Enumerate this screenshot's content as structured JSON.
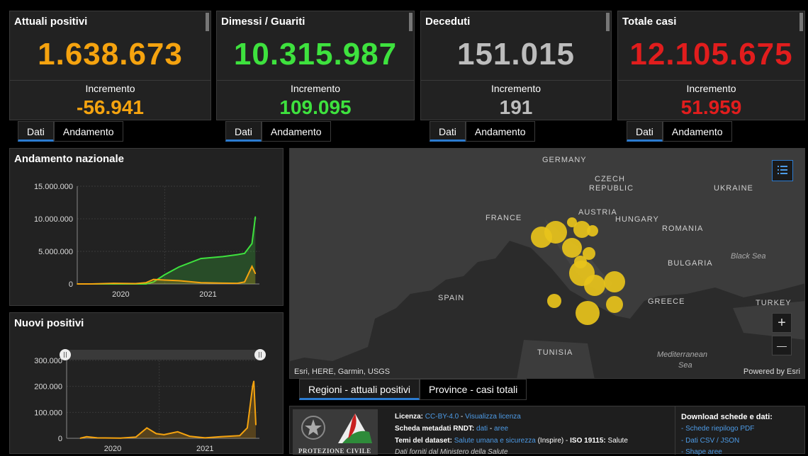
{
  "colors": {
    "orange": "#f5a30f",
    "green": "#3ee23e",
    "gray": "#bdbdbd",
    "red": "#e11d1d",
    "link": "#4d9be6"
  },
  "cards": [
    {
      "title": "Attuali positivi",
      "value": "1.638.673",
      "inc_label": "Incremento",
      "inc_value": "-56.941",
      "color": "orange",
      "tabs": [
        "Dati",
        "Andamento"
      ]
    },
    {
      "title": "Dimessi / Guariti",
      "value": "10.315.987",
      "inc_label": "Incremento",
      "inc_value": "109.095",
      "color": "green",
      "tabs": [
        "Dati",
        "Andamento"
      ]
    },
    {
      "title": "Deceduti",
      "value": "151.015",
      "inc_label": "Incremento",
      "inc_value": "191",
      "color": "gray",
      "tabs": [
        "Dati",
        "Andamento"
      ]
    },
    {
      "title": "Totale casi",
      "value": "12.105.675",
      "inc_label": "Incremento",
      "inc_value": "51.959",
      "color": "red",
      "tabs": [
        "Dati",
        "Andamento"
      ]
    }
  ],
  "andamento": {
    "title": "Andamento nazionale"
  },
  "nuovi": {
    "title": "Nuovi positivi"
  },
  "chart_data": [
    {
      "type": "area",
      "title": "Andamento nazionale",
      "xlabel": "",
      "ylabel": "",
      "x_ticks": [
        "2020",
        "2021"
      ],
      "y_ticks": [
        "15.000.000",
        "10.000.000",
        "5.000.000",
        "0"
      ],
      "ylim": [
        0,
        15000000
      ],
      "x": [
        "2020-01-01",
        "2020-03-01",
        "2020-06-01",
        "2020-09-01",
        "2020-10-15",
        "2020-11-15",
        "2020-12-31",
        "2021-03-01",
        "2021-06-01",
        "2021-09-01",
        "2021-11-01",
        "2021-12-01",
        "2022-01-01",
        "2022-01-15"
      ],
      "series": [
        {
          "color": "#3ee23e",
          "values": [
            0,
            0,
            0,
            0,
            0,
            300000,
            1400000,
            2600000,
            3900000,
            4200000,
            4500000,
            4700000,
            6200000,
            10300000
          ]
        },
        {
          "color": "#f5a30f",
          "values": [
            0,
            0,
            100000,
            50000,
            200000,
            700000,
            600000,
            500000,
            200000,
            120000,
            100000,
            300000,
            2700000,
            1600000
          ]
        }
      ],
      "grid": true
    },
    {
      "type": "area",
      "title": "Nuovi positivi",
      "xlabel": "",
      "ylabel": "",
      "x_ticks": [
        "2020",
        "2021"
      ],
      "y_ticks": [
        "300.000",
        "200.000",
        "100.000",
        "0"
      ],
      "ylim": [
        0,
        300000
      ],
      "x": [
        "2020-02-24",
        "2020-03-20",
        "2020-05-01",
        "2020-08-01",
        "2020-10-01",
        "2020-11-13",
        "2020-12-20",
        "2021-01-20",
        "2021-03-15",
        "2021-05-01",
        "2021-07-01",
        "2021-09-01",
        "2021-11-15",
        "2021-12-15",
        "2022-01-05",
        "2022-01-10",
        "2022-01-18"
      ],
      "series": [
        {
          "color": "#f5a30f",
          "values": [
            200,
            6000,
            1500,
            500,
            5000,
            40000,
            18000,
            14000,
            25000,
            8000,
            1500,
            6000,
            10000,
            40000,
            200000,
            220000,
            52000
          ]
        }
      ],
      "grid": true
    }
  ],
  "map": {
    "labels": [
      "GERMANY",
      "CZECH",
      "REPUBLIC",
      "UKRAINE",
      "FRANCE",
      "AUSTRIA",
      "HUNGARY",
      "ROMANIA",
      "BULGARIA",
      "SPAIN",
      "GREECE",
      "TURKEY",
      "TUNISIA"
    ],
    "seas": [
      "Black Sea",
      "Mediterranean",
      "Sea"
    ],
    "attribution": "Esri, HERE, Garmin, USGS",
    "powered": "Powered by Esri",
    "zoom_in": "+",
    "zoom_out": "—"
  },
  "map_tabs": [
    "Regioni - attuali positivi",
    "Province - casi totali"
  ],
  "footer": {
    "logo_text": "PROTEZIONE CIVILE",
    "licenza_label": "Licenza:",
    "licenza_value": "CC-BY-4.0",
    "licenza_sep": " - ",
    "licenza_link": "Visualizza licenza",
    "rndt_label": "Scheda metadati RNDT:",
    "rndt_dati": "dati",
    "rndt_sep": " - ",
    "rndt_aree": "aree",
    "temi_label": "Temi del dataset:",
    "temi_link": "Salute umana e sicurezza",
    "temi_mid": " (Inspire) - ",
    "temi_iso": "ISO 19115:",
    "temi_end": " Salute",
    "fonte": "Dati forniti dal Ministero della Salute",
    "download_title": "Download schede e dati:",
    "downloads": [
      "- Schede riepilogo PDF",
      "- Dati CSV / JSON",
      "- Shape aree"
    ]
  }
}
